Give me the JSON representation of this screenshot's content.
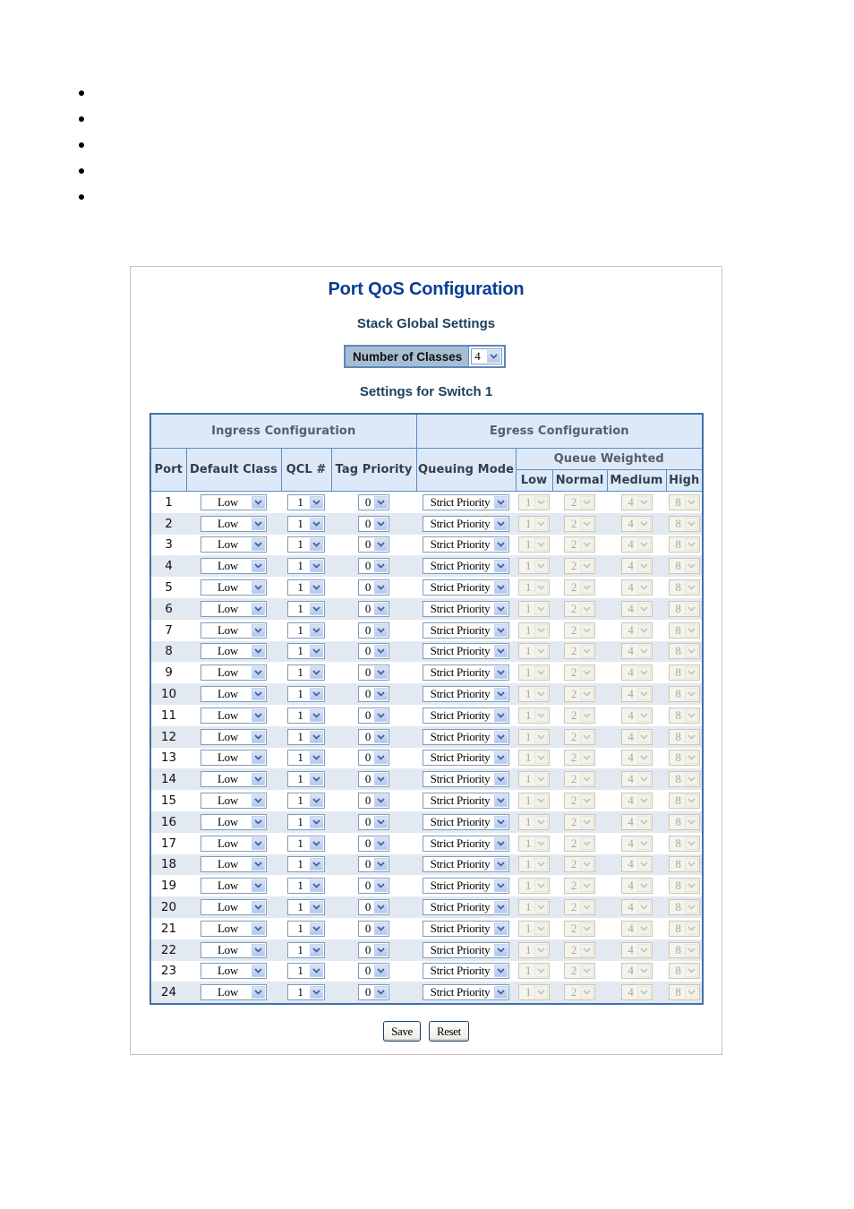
{
  "bullets": [
    "",
    "",
    "",
    "",
    ""
  ],
  "page": {
    "title": "Port QoS Configuration",
    "stack_global_heading": "Stack Global Settings",
    "number_of_classes_label": "Number of Classes",
    "number_of_classes_value": "4",
    "switch_heading": "Settings for Switch 1"
  },
  "table": {
    "ingress_header": "Ingress Configuration",
    "egress_header": "Egress Configuration",
    "queue_weighted_header": "Queue Weighted",
    "columns": {
      "port": "Port",
      "default_class": "Default Class",
      "qcl": "QCL #",
      "tag_priority": "Tag Priority",
      "queuing_mode": "Queuing Mode",
      "low": "Low",
      "normal": "Normal",
      "medium": "Medium",
      "high": "High"
    },
    "rows": [
      {
        "port": "1",
        "default_class": "Low",
        "qcl": "1",
        "tag_priority": "0",
        "queuing_mode": "Strict Priority",
        "low": "1",
        "normal": "2",
        "medium": "4",
        "high": "8"
      },
      {
        "port": "2",
        "default_class": "Low",
        "qcl": "1",
        "tag_priority": "0",
        "queuing_mode": "Strict Priority",
        "low": "1",
        "normal": "2",
        "medium": "4",
        "high": "8"
      },
      {
        "port": "3",
        "default_class": "Low",
        "qcl": "1",
        "tag_priority": "0",
        "queuing_mode": "Strict Priority",
        "low": "1",
        "normal": "2",
        "medium": "4",
        "high": "8"
      },
      {
        "port": "4",
        "default_class": "Low",
        "qcl": "1",
        "tag_priority": "0",
        "queuing_mode": "Strict Priority",
        "low": "1",
        "normal": "2",
        "medium": "4",
        "high": "8"
      },
      {
        "port": "5",
        "default_class": "Low",
        "qcl": "1",
        "tag_priority": "0",
        "queuing_mode": "Strict Priority",
        "low": "1",
        "normal": "2",
        "medium": "4",
        "high": "8"
      },
      {
        "port": "6",
        "default_class": "Low",
        "qcl": "1",
        "tag_priority": "0",
        "queuing_mode": "Strict Priority",
        "low": "1",
        "normal": "2",
        "medium": "4",
        "high": "8"
      },
      {
        "port": "7",
        "default_class": "Low",
        "qcl": "1",
        "tag_priority": "0",
        "queuing_mode": "Strict Priority",
        "low": "1",
        "normal": "2",
        "medium": "4",
        "high": "8"
      },
      {
        "port": "8",
        "default_class": "Low",
        "qcl": "1",
        "tag_priority": "0",
        "queuing_mode": "Strict Priority",
        "low": "1",
        "normal": "2",
        "medium": "4",
        "high": "8"
      },
      {
        "port": "9",
        "default_class": "Low",
        "qcl": "1",
        "tag_priority": "0",
        "queuing_mode": "Strict Priority",
        "low": "1",
        "normal": "2",
        "medium": "4",
        "high": "8"
      },
      {
        "port": "10",
        "default_class": "Low",
        "qcl": "1",
        "tag_priority": "0",
        "queuing_mode": "Strict Priority",
        "low": "1",
        "normal": "2",
        "medium": "4",
        "high": "8"
      },
      {
        "port": "11",
        "default_class": "Low",
        "qcl": "1",
        "tag_priority": "0",
        "queuing_mode": "Strict Priority",
        "low": "1",
        "normal": "2",
        "medium": "4",
        "high": "8"
      },
      {
        "port": "12",
        "default_class": "Low",
        "qcl": "1",
        "tag_priority": "0",
        "queuing_mode": "Strict Priority",
        "low": "1",
        "normal": "2",
        "medium": "4",
        "high": "8"
      },
      {
        "port": "13",
        "default_class": "Low",
        "qcl": "1",
        "tag_priority": "0",
        "queuing_mode": "Strict Priority",
        "low": "1",
        "normal": "2",
        "medium": "4",
        "high": "8"
      },
      {
        "port": "14",
        "default_class": "Low",
        "qcl": "1",
        "tag_priority": "0",
        "queuing_mode": "Strict Priority",
        "low": "1",
        "normal": "2",
        "medium": "4",
        "high": "8"
      },
      {
        "port": "15",
        "default_class": "Low",
        "qcl": "1",
        "tag_priority": "0",
        "queuing_mode": "Strict Priority",
        "low": "1",
        "normal": "2",
        "medium": "4",
        "high": "8"
      },
      {
        "port": "16",
        "default_class": "Low",
        "qcl": "1",
        "tag_priority": "0",
        "queuing_mode": "Strict Priority",
        "low": "1",
        "normal": "2",
        "medium": "4",
        "high": "8"
      },
      {
        "port": "17",
        "default_class": "Low",
        "qcl": "1",
        "tag_priority": "0",
        "queuing_mode": "Strict Priority",
        "low": "1",
        "normal": "2",
        "medium": "4",
        "high": "8"
      },
      {
        "port": "18",
        "default_class": "Low",
        "qcl": "1",
        "tag_priority": "0",
        "queuing_mode": "Strict Priority",
        "low": "1",
        "normal": "2",
        "medium": "4",
        "high": "8"
      },
      {
        "port": "19",
        "default_class": "Low",
        "qcl": "1",
        "tag_priority": "0",
        "queuing_mode": "Strict Priority",
        "low": "1",
        "normal": "2",
        "medium": "4",
        "high": "8"
      },
      {
        "port": "20",
        "default_class": "Low",
        "qcl": "1",
        "tag_priority": "0",
        "queuing_mode": "Strict Priority",
        "low": "1",
        "normal": "2",
        "medium": "4",
        "high": "8"
      },
      {
        "port": "21",
        "default_class": "Low",
        "qcl": "1",
        "tag_priority": "0",
        "queuing_mode": "Strict Priority",
        "low": "1",
        "normal": "2",
        "medium": "4",
        "high": "8"
      },
      {
        "port": "22",
        "default_class": "Low",
        "qcl": "1",
        "tag_priority": "0",
        "queuing_mode": "Strict Priority",
        "low": "1",
        "normal": "2",
        "medium": "4",
        "high": "8"
      },
      {
        "port": "23",
        "default_class": "Low",
        "qcl": "1",
        "tag_priority": "0",
        "queuing_mode": "Strict Priority",
        "low": "1",
        "normal": "2",
        "medium": "4",
        "high": "8"
      },
      {
        "port": "24",
        "default_class": "Low",
        "qcl": "1",
        "tag_priority": "0",
        "queuing_mode": "Strict Priority",
        "low": "1",
        "normal": "2",
        "medium": "4",
        "high": "8"
      }
    ]
  },
  "buttons": {
    "save": "Save",
    "reset": "Reset"
  },
  "colors": {
    "title": "#0a3d96",
    "header_bg": "#dde9f8",
    "table_border": "#3f72aa",
    "row_alt_bg": "#e2e9f1"
  },
  "icons": {
    "dropdown": "chevron-down-icon",
    "bullet": "bullet-icon"
  }
}
